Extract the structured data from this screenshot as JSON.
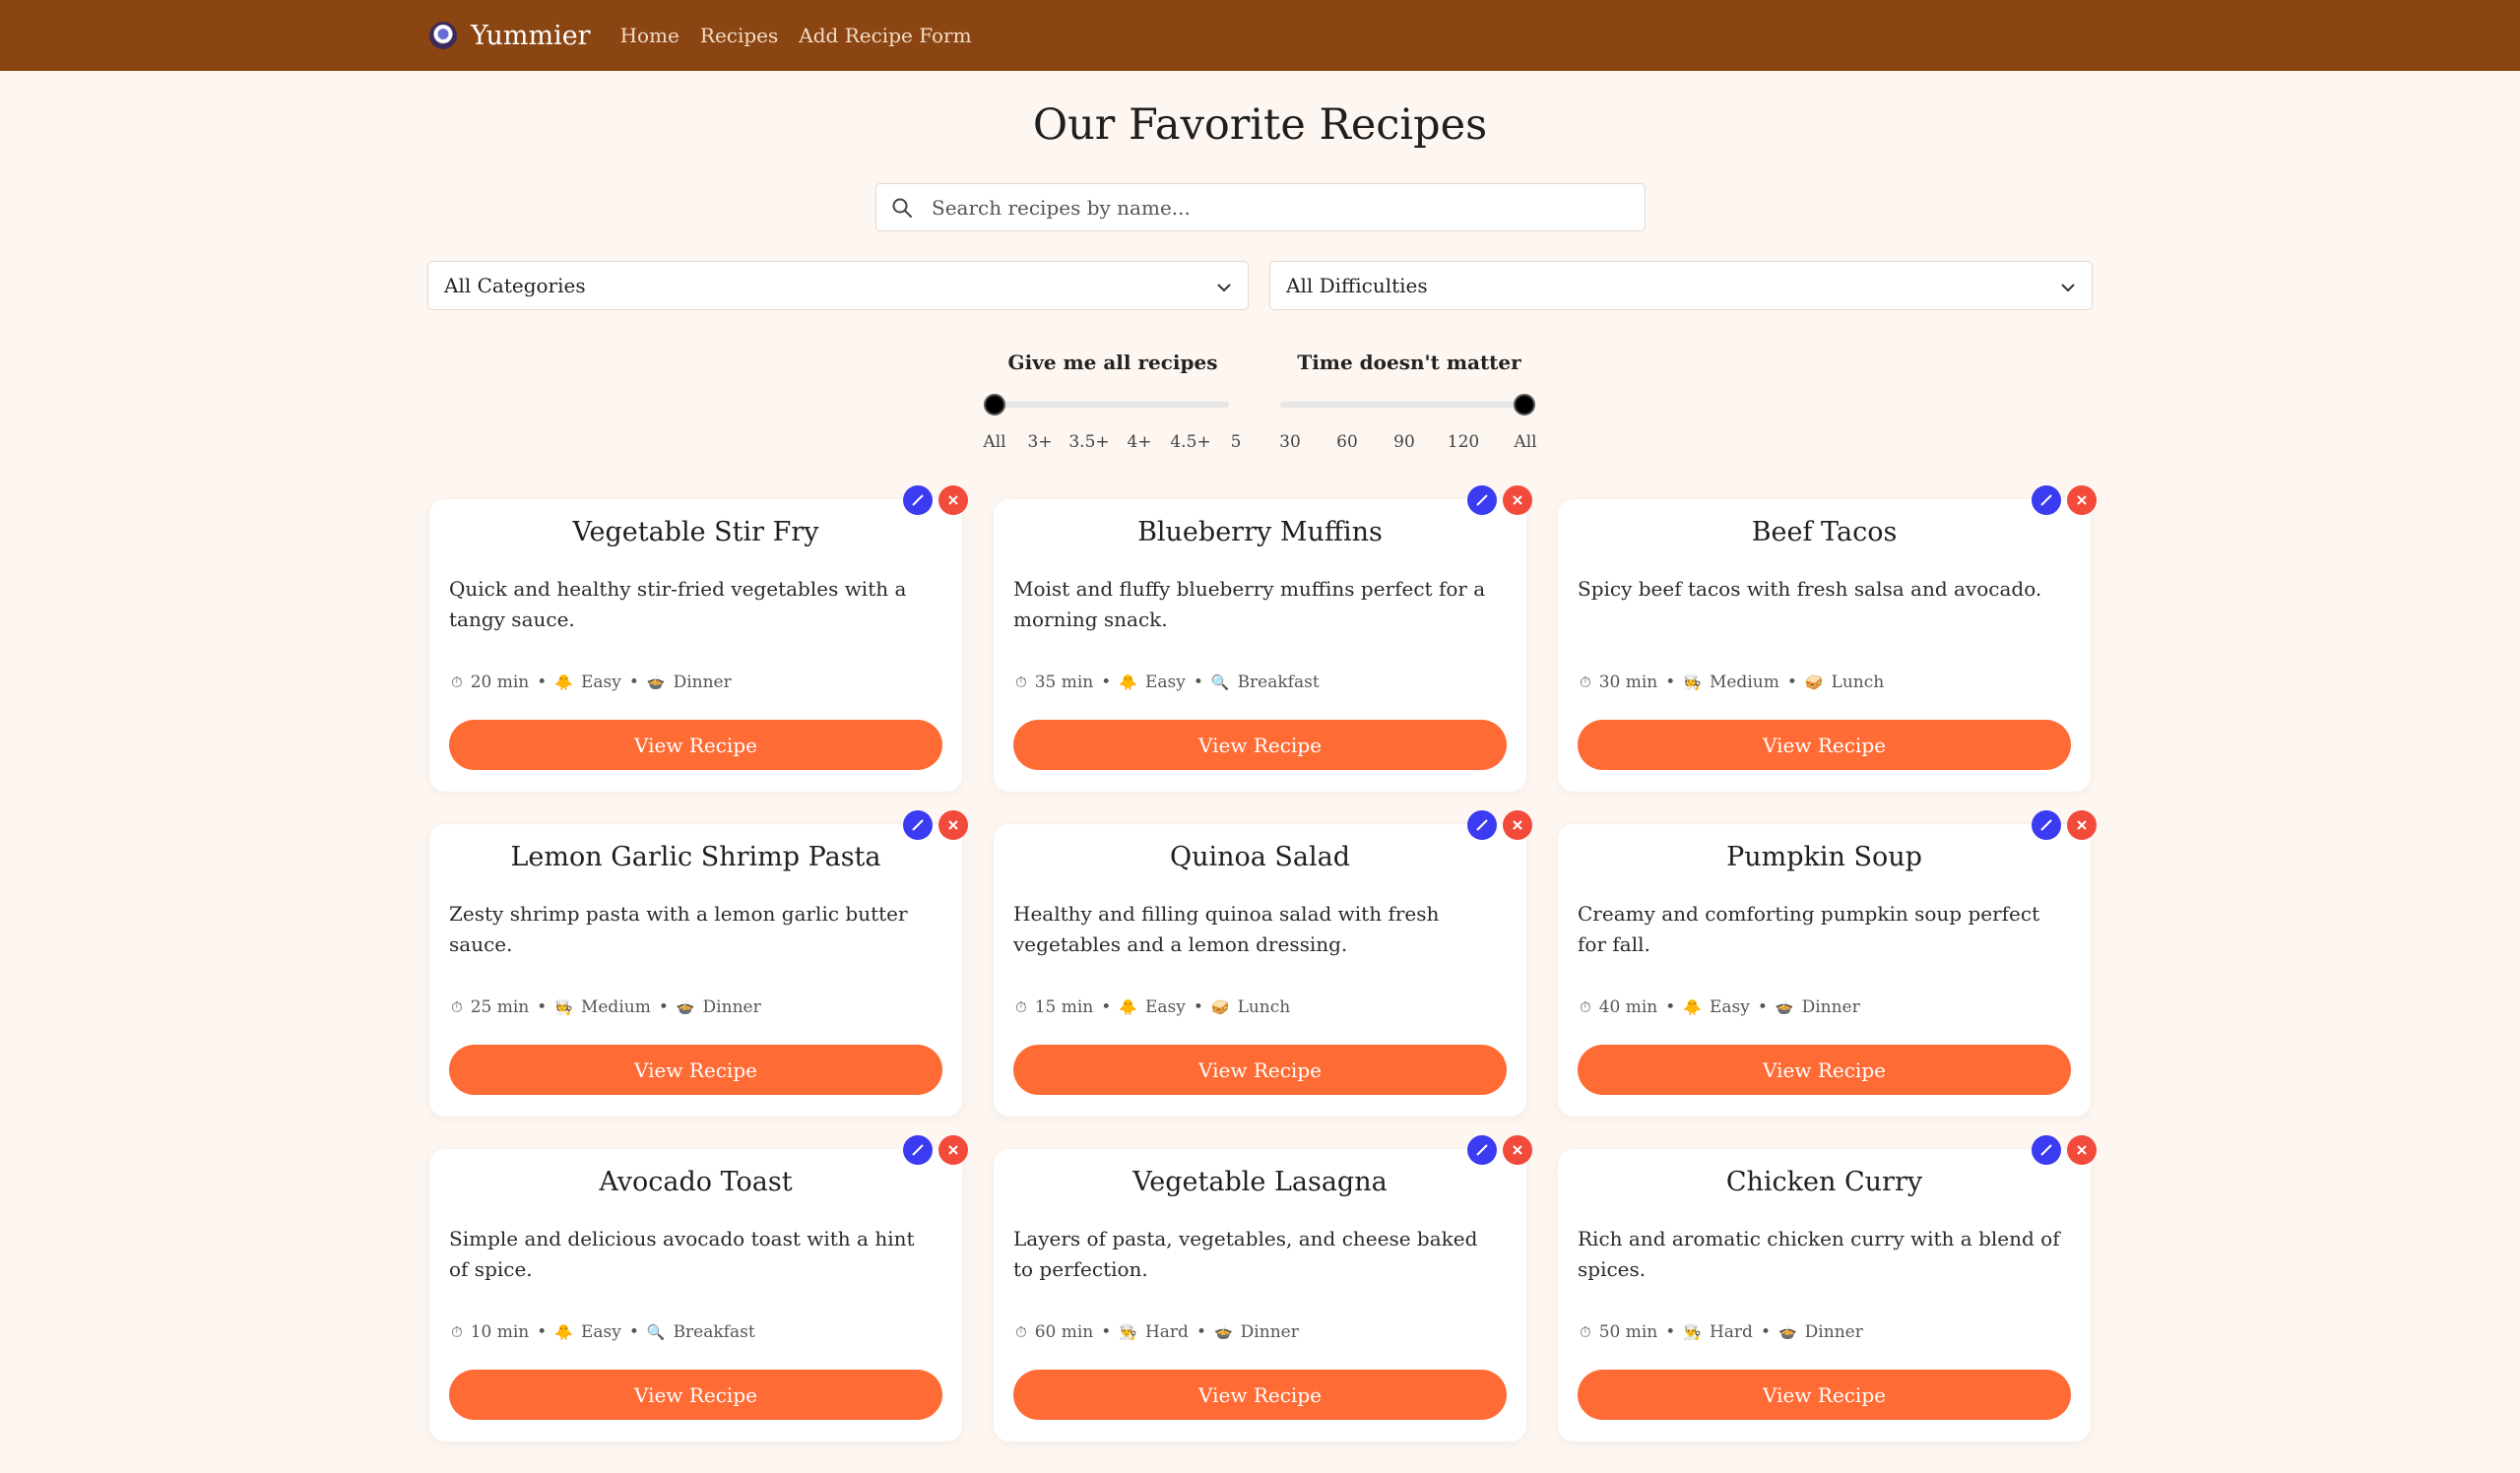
{
  "navbar": {
    "brand": "Yummier",
    "links": [
      "Home",
      "Recipes",
      "Add Recipe Form"
    ]
  },
  "page": {
    "title": "Our Favorite Recipes"
  },
  "search": {
    "placeholder": "Search recipes by name..."
  },
  "filters": {
    "category_selected": "All Categories",
    "difficulty_selected": "All Difficulties"
  },
  "rating_slider": {
    "label": "Give me all recipes",
    "ticks": [
      "All",
      "3+",
      "3.5+",
      "4+",
      "4.5+",
      "5"
    ],
    "selected": "All"
  },
  "time_slider": {
    "label": "Time doesn't matter",
    "ticks": [
      "30",
      "60",
      "90",
      "120",
      "All"
    ],
    "selected": "All"
  },
  "recipes": [
    {
      "title": "Vegetable Stir Fry",
      "description": "Quick and healthy stir-fried vegetables with a tangy sauce.",
      "time": "20 min",
      "difficulty": "Easy",
      "category": "Dinner",
      "button": "View Recipe"
    },
    {
      "title": "Blueberry Muffins",
      "description": "Moist and fluffy blueberry muffins perfect for a morning snack.",
      "time": "35 min",
      "difficulty": "Easy",
      "category": "Breakfast",
      "button": "View Recipe"
    },
    {
      "title": "Beef Tacos",
      "description": "Spicy beef tacos with fresh salsa and avocado.",
      "time": "30 min",
      "difficulty": "Medium",
      "category": "Lunch",
      "button": "View Recipe"
    },
    {
      "title": "Lemon Garlic Shrimp Pasta",
      "description": "Zesty shrimp pasta with a lemon garlic butter sauce.",
      "time": "25 min",
      "difficulty": "Medium",
      "category": "Dinner",
      "button": "View Recipe"
    },
    {
      "title": "Quinoa Salad",
      "description": "Healthy and filling quinoa salad with fresh vegetables and a lemon dressing.",
      "time": "15 min",
      "difficulty": "Easy",
      "category": "Lunch",
      "button": "View Recipe"
    },
    {
      "title": "Pumpkin Soup",
      "description": "Creamy and comforting pumpkin soup perfect for fall.",
      "time": "40 min",
      "difficulty": "Easy",
      "category": "Dinner",
      "button": "View Recipe"
    },
    {
      "title": "Avocado Toast",
      "description": "Simple and delicious avocado toast with a hint of spice.",
      "time": "10 min",
      "difficulty": "Easy",
      "category": "Breakfast",
      "button": "View Recipe"
    },
    {
      "title": "Vegetable Lasagna",
      "description": "Layers of pasta, vegetables, and cheese baked to perfection.",
      "time": "60 min",
      "difficulty": "Hard",
      "category": "Dinner",
      "button": "View Recipe"
    },
    {
      "title": "Chicken Curry",
      "description": "Rich and aromatic chicken curry with a blend of spices.",
      "time": "50 min",
      "difficulty": "Hard",
      "category": "Dinner",
      "button": "View Recipe"
    }
  ],
  "icons": {
    "time": "stopwatch-icon",
    "easy": "baby-chick-icon",
    "medium": "cook-icon",
    "hard": "chef-icon",
    "dinner": "dinner-plate-icon",
    "breakfast": "magnifier-icon",
    "lunch": "sandwich-icon",
    "edit": "pencil-icon",
    "delete": "close-icon"
  },
  "colors": {
    "navbar": "#8b4513",
    "page_bg": "#fdf6f1",
    "primary_button": "#ff6b35",
    "edit": "#3b3bf2",
    "delete": "#f24a3b"
  }
}
